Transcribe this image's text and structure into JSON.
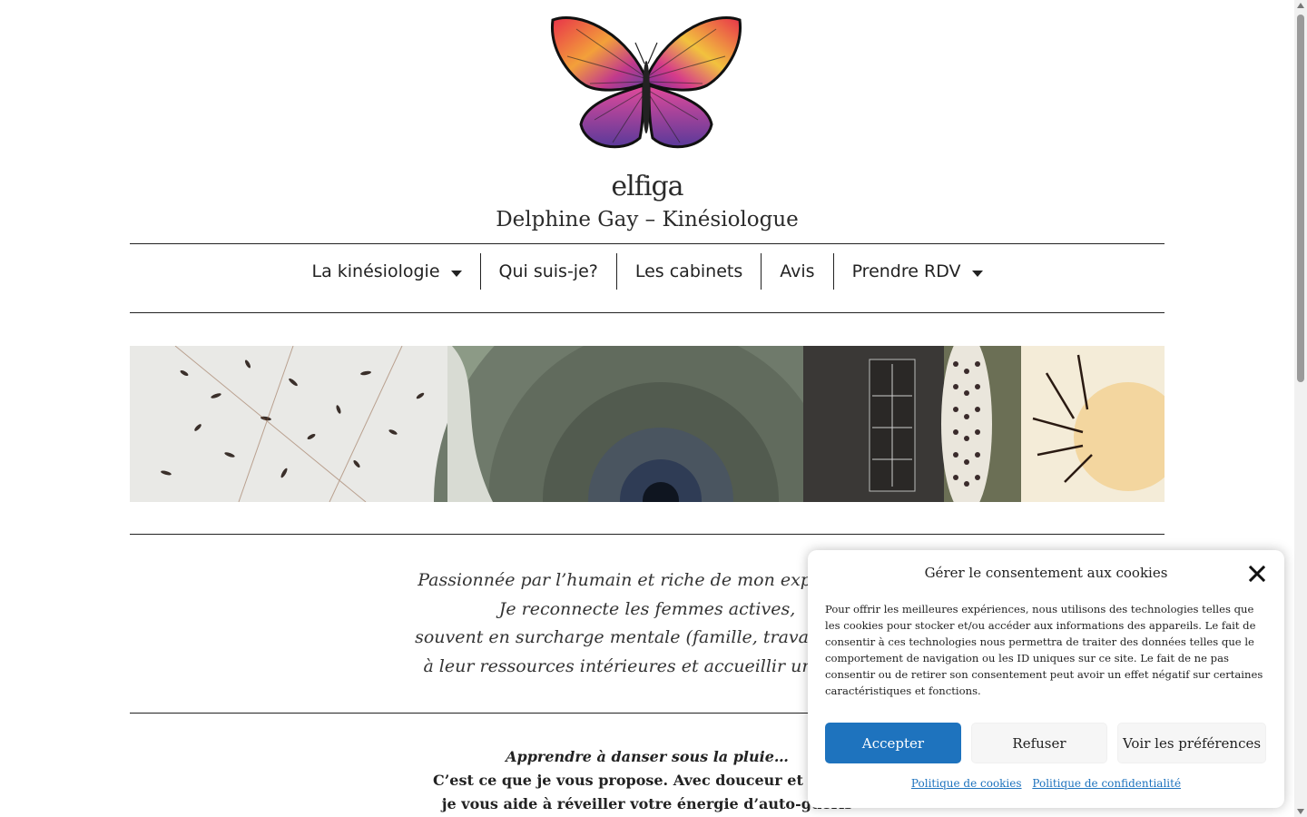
{
  "header": {
    "brand_name": "elfiga",
    "brand_subtitle": "Delphine Gay – Kinésiologue"
  },
  "nav": {
    "items": [
      {
        "label": "La kinésiologie",
        "has_dropdown": true
      },
      {
        "label": "Qui suis-je?",
        "has_dropdown": false
      },
      {
        "label": "Les cabinets",
        "has_dropdown": false
      },
      {
        "label": "Avis",
        "has_dropdown": false
      },
      {
        "label": "Prendre RDV",
        "has_dropdown": true
      }
    ]
  },
  "intro": {
    "lines": [
      "Passionnée par l’humain et riche de mon expérience",
      "Je reconnecte les femmes actives,",
      "souvent en surcharge mentale (famille, travail, respo",
      "à leur ressources intérieures et accueillir un nouve"
    ]
  },
  "pitch": {
    "line1": "Apprendre à danser sous la pluie…",
    "line2": "C’est ce que je vous propose. Avec douceur et bienve",
    "line3": "je vous aide à réveiller votre énergie d’auto-guéris"
  },
  "cookie": {
    "title": "Gérer le consentement aux cookies",
    "body": "Pour offrir les meilleures expériences, nous utilisons des technologies telles que les cookies pour stocker et/ou accéder aux informations des appareils. Le fait de consentir à ces technologies nous permettra de traiter des données telles que le comportement de navigation ou les ID uniques sur ce site. Le fait de ne pas consentir ou de retirer son consentement peut avoir un effet négatif sur certaines caractéristiques et fonctions.",
    "accept_label": "Accepter",
    "deny_label": "Refuser",
    "prefs_label": "Voir les préférences",
    "cookie_policy_link": "Politique de cookies",
    "privacy_policy_link": "Politique de confidentialité"
  },
  "colors": {
    "accent": "#1e73be",
    "text": "#222222"
  }
}
